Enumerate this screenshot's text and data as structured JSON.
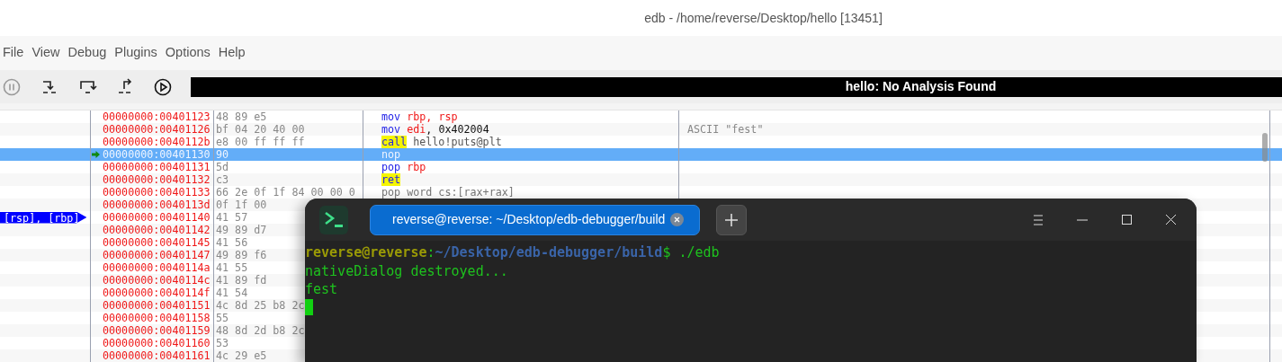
{
  "window": {
    "title": "edb - /home/reverse/Desktop/hello [13451]"
  },
  "menu": [
    "File",
    "View",
    "Debug",
    "Plugins",
    "Options",
    "Help"
  ],
  "analysis_bar": {
    "text": "hello: No Analysis Found"
  },
  "disassembly": {
    "rows": [
      {
        "address": "00000000:00401123",
        "bytes": "48 89 e5",
        "instruction": {
          "mnemonic": {
            "text": "mov",
            "kind": "op"
          },
          "operands": [
            {
              "text": "rbp",
              "kind": "reg"
            },
            {
              "text": ", ",
              "kind": "reg"
            },
            {
              "text": "rsp",
              "kind": "reg"
            }
          ]
        },
        "selected": false,
        "current": false
      },
      {
        "address": "00000000:00401126",
        "bytes": "bf 04 20 40 00",
        "instruction": {
          "mnemonic": {
            "text": "mov",
            "kind": "op"
          },
          "operands": [
            {
              "text": "edi",
              "kind": "reg"
            },
            {
              "text": ", ",
              "kind": "imm"
            },
            {
              "text": "0x402004",
              "kind": "imm"
            }
          ]
        },
        "comment": "ASCII \"fest\"",
        "selected": false,
        "current": false
      },
      {
        "address": "00000000:0040112b",
        "bytes": "e8 00 ff ff ff",
        "instruction": {
          "mnemonic": {
            "text": "call",
            "kind": "flow"
          },
          "operands": [
            {
              "text": "hello!puts@plt",
              "kind": "sym"
            }
          ]
        },
        "selected": false,
        "current": false
      },
      {
        "address": "00000000:00401130",
        "bytes": "90",
        "instruction": {
          "mnemonic": {
            "text": "nop",
            "kind": "op"
          }
        },
        "selected": true,
        "current": true
      },
      {
        "address": "00000000:00401131",
        "bytes": "5d",
        "instruction": {
          "mnemonic": {
            "text": "pop",
            "kind": "op"
          },
          "operands": [
            {
              "text": "rbp",
              "kind": "reg"
            }
          ]
        },
        "selected": false,
        "current": false
      },
      {
        "address": "00000000:00401132",
        "bytes": "c3",
        "instruction": {
          "mnemonic": {
            "text": "ret",
            "kind": "flow"
          }
        },
        "selected": false,
        "current": false
      },
      {
        "address": "00000000:00401133",
        "bytes": "66 2e 0f 1f 84 00 00 0",
        "instruction": {
          "mnemonic": {
            "text": "pop",
            "kind": "faint"
          },
          "operands": [
            {
              "text": "word cs:[rax+rax]",
              "kind": "faint"
            }
          ]
        },
        "selected": false,
        "current": false
      },
      {
        "address": "00000000:0040113d",
        "bytes": "0f 1f 00",
        "selected": false,
        "current": false
      },
      {
        "address": "00000000:00401140",
        "bytes": "41 57",
        "label": "[rsp], [rbp]",
        "selected": false,
        "current": false
      },
      {
        "address": "00000000:00401142",
        "bytes": "49 89 d7",
        "selected": false,
        "current": false
      },
      {
        "address": "00000000:00401145",
        "bytes": "41 56",
        "selected": false,
        "current": false
      },
      {
        "address": "00000000:00401147",
        "bytes": "49 89 f6",
        "selected": false,
        "current": false
      },
      {
        "address": "00000000:0040114a",
        "bytes": "41 55",
        "selected": false,
        "current": false
      },
      {
        "address": "00000000:0040114c",
        "bytes": "41 89 fd",
        "selected": false,
        "current": false
      },
      {
        "address": "00000000:0040114f",
        "bytes": "41 54",
        "selected": false,
        "current": false
      },
      {
        "address": "00000000:00401151",
        "bytes": "4c 8d 25 b8 2c",
        "selected": false,
        "current": false
      },
      {
        "address": "00000000:00401158",
        "bytes": "55",
        "selected": false,
        "current": false
      },
      {
        "address": "00000000:00401159",
        "bytes": "48 8d 2d b8 2c",
        "selected": false,
        "current": false
      },
      {
        "address": "00000000:00401160",
        "bytes": "53",
        "selected": false,
        "current": false
      },
      {
        "address": "00000000:00401161",
        "bytes": "4c 29 e5",
        "selected": false,
        "current": false
      }
    ]
  },
  "terminal": {
    "tab_title": "reverse@reverse: ~/Desktop/edb-debugger/build",
    "lines": [
      [
        {
          "text": "reverse@reverse",
          "kind": "user"
        },
        {
          "text": ":",
          "kind": "out"
        },
        {
          "text": "~/Desktop/edb-debugger/build",
          "kind": "path"
        },
        {
          "text": "$ ./edb",
          "kind": "out"
        }
      ],
      [
        {
          "text": "nativeDialog destroyed...",
          "kind": "out"
        }
      ],
      [
        {
          "text": "fest",
          "kind": "out"
        }
      ]
    ],
    "cursor": true
  }
}
